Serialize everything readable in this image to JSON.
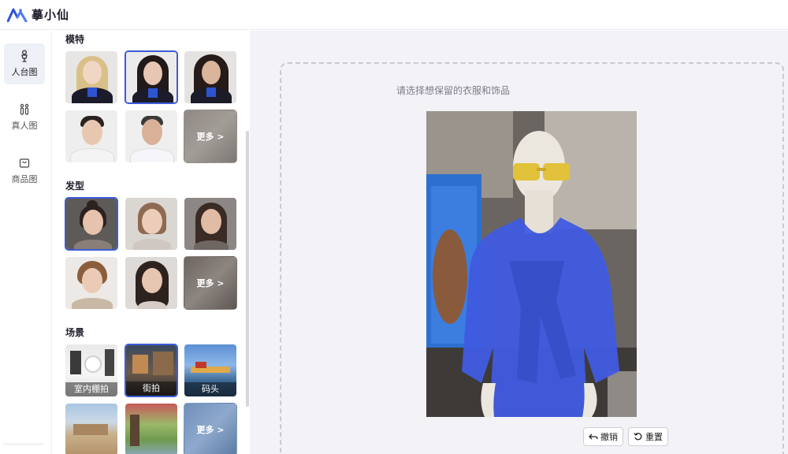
{
  "app": {
    "name": "摹小仙",
    "brand_color": "#3d5bd8"
  },
  "nav": {
    "items": [
      {
        "label": "人台图",
        "icon": "mannequin-icon",
        "active": true
      },
      {
        "label": "真人图",
        "icon": "people-icon",
        "active": false
      },
      {
        "label": "商品图",
        "icon": "bag-icon",
        "active": false
      }
    ]
  },
  "panel": {
    "models": {
      "title": "模特",
      "items": [
        {
          "kind": "blonde-woman",
          "selected": false
        },
        {
          "kind": "dark-haired-woman",
          "selected": true
        },
        {
          "kind": "long-haired-woman",
          "selected": false
        },
        {
          "kind": "young-man",
          "selected": false
        },
        {
          "kind": "older-man",
          "selected": false
        }
      ],
      "more_label": "更多 >"
    },
    "hairstyles": {
      "title": "发型",
      "items": [
        {
          "kind": "bun",
          "selected": true
        },
        {
          "kind": "ponytail",
          "selected": false
        },
        {
          "kind": "braids",
          "selected": false
        },
        {
          "kind": "short-curly",
          "selected": false
        },
        {
          "kind": "long-wavy",
          "selected": false
        }
      ],
      "more_label": "更多 >"
    },
    "scenes": {
      "title": "场景",
      "items": [
        {
          "label": "室内棚拍",
          "kind": "studio",
          "selected": false
        },
        {
          "label": "街拍",
          "kind": "street",
          "selected": true
        },
        {
          "label": "码头",
          "kind": "pier",
          "selected": false
        },
        {
          "label": "",
          "kind": "desert",
          "selected": false
        },
        {
          "label": "",
          "kind": "park",
          "selected": false
        }
      ],
      "more_label": "更多 >"
    }
  },
  "main": {
    "hint": "请选择想保留的衣服和饰品",
    "undo_label": "撤销",
    "reset_label": "重置",
    "mask_color": "#3f5be0"
  }
}
